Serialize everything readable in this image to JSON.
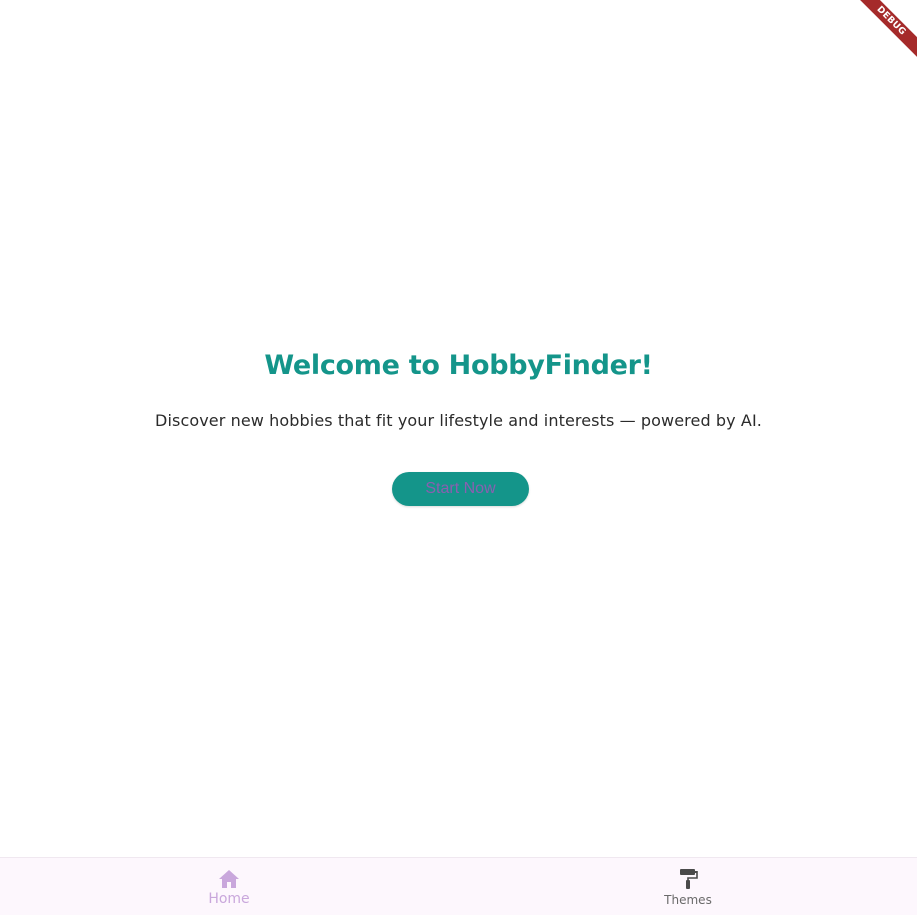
{
  "debug_banner": {
    "label": "DEBUG"
  },
  "main": {
    "title": "Welcome to HobbyFinder!",
    "subtitle": "Discover new hobbies that fit your lifestyle and interests — powered by AI.",
    "start_button_label": "Start Now"
  },
  "bottom_nav": {
    "items": [
      {
        "label": "Home",
        "icon": "home-icon",
        "active": true
      },
      {
        "label": "Themes",
        "icon": "paint-roller-icon",
        "active": false
      }
    ]
  },
  "colors": {
    "accent": "#14958a",
    "active_nav": "#c9a7dc",
    "inactive_nav": "#6a6a6a",
    "button_text": "#8a5fb0",
    "nav_background": "#fdf7fd",
    "debug_ribbon": "#a52a2a"
  }
}
